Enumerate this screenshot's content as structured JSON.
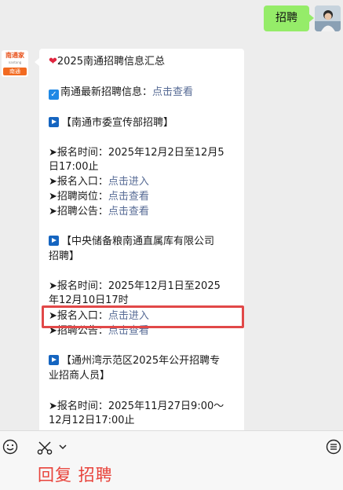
{
  "user_message": {
    "text": "招聘"
  },
  "account": {
    "logo_text": "南通家",
    "logo_sub": "nantong",
    "logo_city": "南通"
  },
  "message": {
    "title": "2025南通招聘信息汇总",
    "latest_label": "南通最新招聘信息：",
    "latest_link": "点击查看",
    "sections": [
      {
        "heading": "【南通市委宣传部招聘】",
        "time_line1": "➤报名时间：2025年12月2日至12月5",
        "time_line2": "日17:00止",
        "entry_label": "➤报名入口：",
        "entry_link": "点击进入",
        "position_label": "➤招聘岗位：",
        "position_link": "点击查看",
        "notice_label": "➤招聘公告：",
        "notice_link": "点击查看"
      },
      {
        "heading_line1": "【中央储备粮南通直属库有限公司",
        "heading_line2": "招聘】",
        "time_line1": "➤报名时间：2025年12月1日至2025",
        "time_line2": "年12月10日17时",
        "entry_label": "➤报名入口：",
        "entry_link": "点击进入",
        "notice_label": "➤招聘公告：",
        "notice_link": "点击查看"
      },
      {
        "heading_line1": "【通州湾示范区2025年公开招聘专",
        "heading_line2": "业招商人员】",
        "time_line1": "➤报名时间：2025年11月27日9:00～",
        "time_line2": "12月12日17:00止"
      }
    ]
  },
  "input_bar": {
    "reply_hint": "回复 招聘"
  },
  "colors": {
    "link": "#576b95",
    "user_bubble": "#95ec69",
    "highlight": "#e14848",
    "hint": "#e8423a"
  }
}
